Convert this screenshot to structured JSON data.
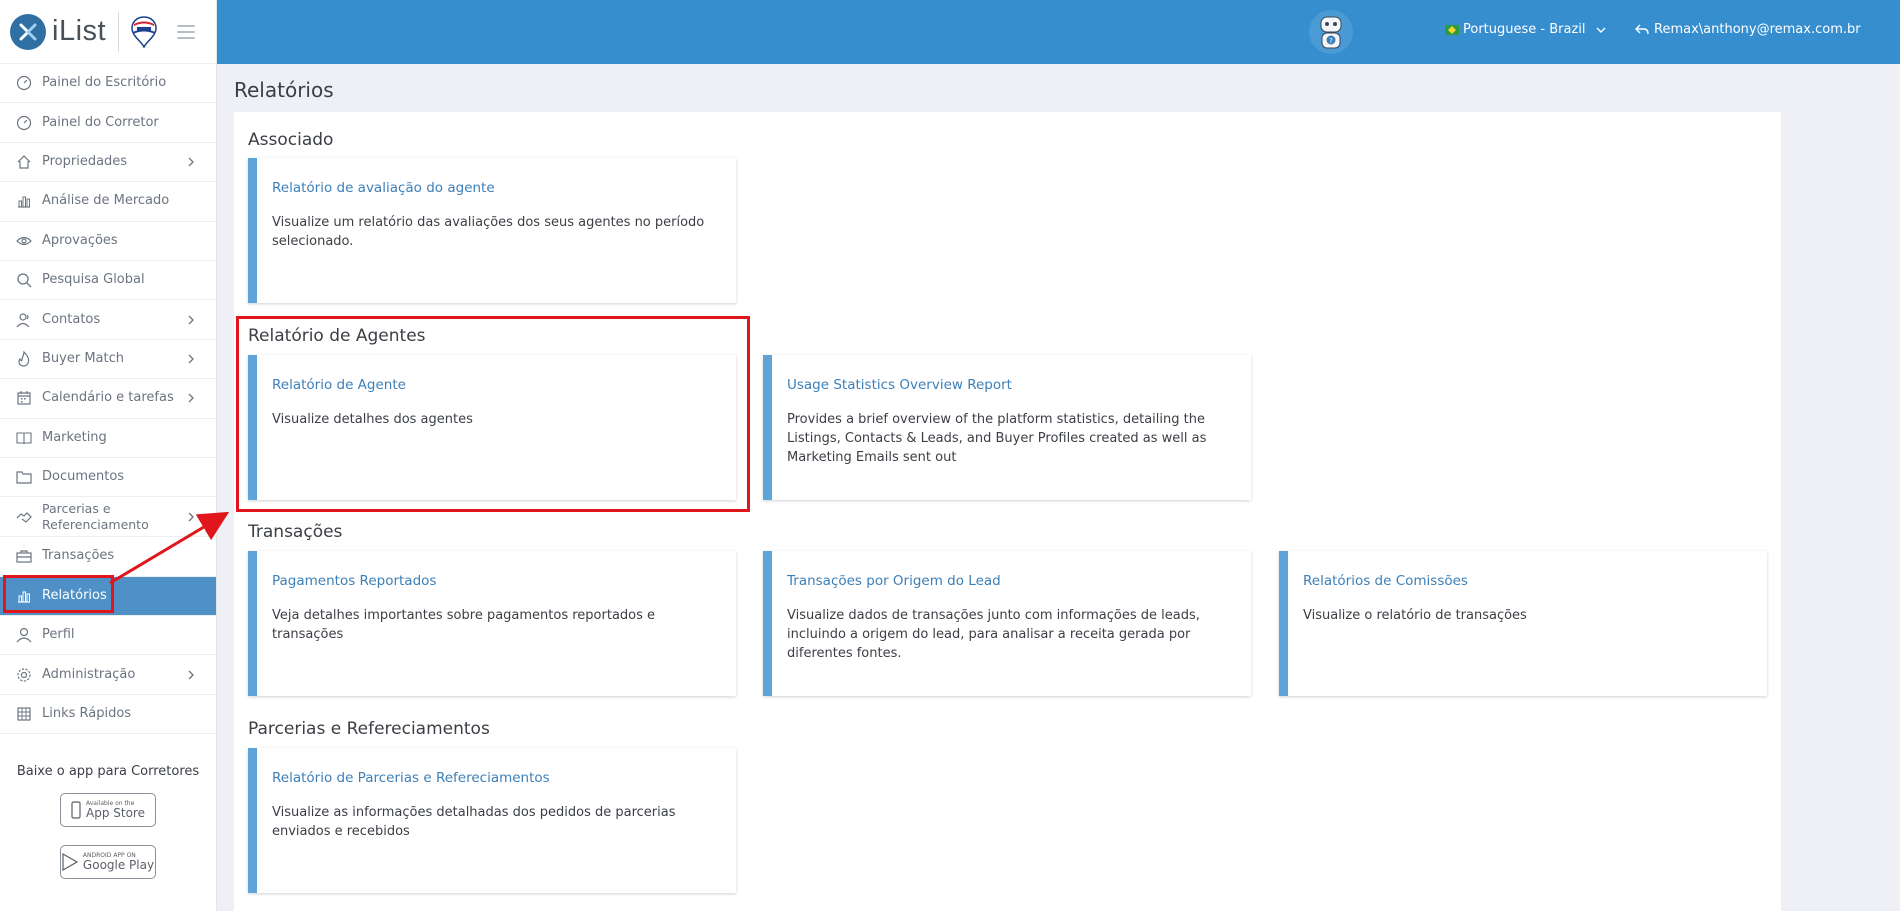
{
  "app": {
    "brand": "iList",
    "partner_badge": "RE/MAX"
  },
  "topbar": {
    "language": "Portuguese - Brazil",
    "user": "Remax\\anthony@remax.com.br"
  },
  "sidebar": {
    "items": [
      {
        "label": "Painel do Escritório",
        "icon": "gauge-icon",
        "has_children": false
      },
      {
        "label": "Painel do Corretor",
        "icon": "gauge-icon",
        "has_children": false
      },
      {
        "label": "Propriedades",
        "icon": "home-icon",
        "has_children": true
      },
      {
        "label": "Análise de Mercado",
        "icon": "bar-chart-icon",
        "has_children": false
      },
      {
        "label": "Aprovações",
        "icon": "eye-icon",
        "has_children": false
      },
      {
        "label": "Pesquisa Global",
        "icon": "search-icon",
        "has_children": false
      },
      {
        "label": "Contatos",
        "icon": "contacts-icon",
        "has_children": true
      },
      {
        "label": "Buyer Match",
        "icon": "flame-icon",
        "has_children": true
      },
      {
        "label": "Calendário e tarefas",
        "icon": "calendar-icon",
        "has_children": true
      },
      {
        "label": "Marketing",
        "icon": "book-icon",
        "has_children": false
      },
      {
        "label": "Documentos",
        "icon": "folder-icon",
        "has_children": false
      },
      {
        "label": "Parcerias e Referenciamento",
        "icon": "handshake-icon",
        "has_children": true
      },
      {
        "label": "Transações",
        "icon": "briefcase-icon",
        "has_children": false
      },
      {
        "label": "Relatórios",
        "icon": "bar-chart-icon",
        "has_children": false,
        "active": true
      },
      {
        "label": "Perfil",
        "icon": "user-icon",
        "has_children": false
      },
      {
        "label": "Administração",
        "icon": "gear-icon",
        "has_children": true
      },
      {
        "label": "Links Rápidos",
        "icon": "building-icon",
        "has_children": false
      }
    ],
    "app_download_title": "Baixe o app para Corretores",
    "app_store": {
      "small": "Available on the",
      "big": "App Store"
    },
    "google_play": {
      "small": "ANDROID APP ON",
      "big": "Google Play"
    }
  },
  "main": {
    "page_title": "Relatórios",
    "sections": [
      {
        "title": "Associado",
        "cards": [
          {
            "title": "Relatório de avaliação do agente",
            "description": "Visualize um relatório das avaliações dos seus agentes no período selecionado."
          }
        ]
      },
      {
        "title": "Relatório de Agentes",
        "cards": [
          {
            "title": "Relatório de Agente",
            "description": "Visualize detalhes dos agentes"
          },
          {
            "title": "Usage Statistics Overview Report",
            "description": "Provides a brief overview of the platform statistics, detailing the Listings, Contacts & Leads, and Buyer Profiles created as well as Marketing Emails sent out"
          }
        ]
      },
      {
        "title": "Transações",
        "cards": [
          {
            "title": "Pagamentos Reportados",
            "description": "Veja detalhes importantes sobre pagamentos reportados e transações"
          },
          {
            "title": "Transações por Origem do Lead",
            "description": "Visualize dados de transações junto com informações de leads, incluindo a origem do lead, para analisar a receita gerada por diferentes fontes."
          },
          {
            "title": "Relatórios de Comissões",
            "description": "Visualize o relatório de transações"
          }
        ]
      },
      {
        "title": "Parcerias e Refereciamentos",
        "cards": [
          {
            "title": "Relatório de Parcerias e Refereciamentos",
            "description": "Visualize as informações detalhadas dos pedidos de parcerias enviados e recebidos"
          }
        ]
      }
    ]
  },
  "colors": {
    "topbar": "#368ece",
    "active_nav": "#4f90c7",
    "card_accent": "#5ea4d8",
    "annotation": "#e0161c"
  }
}
